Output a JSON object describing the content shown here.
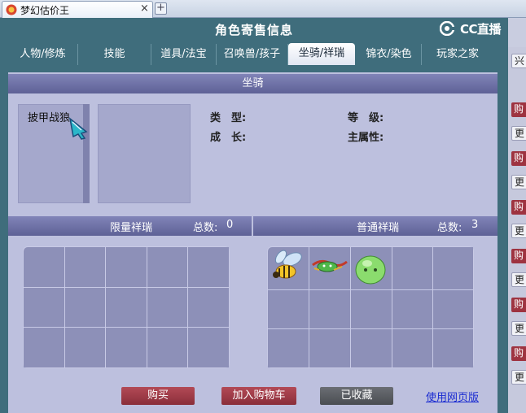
{
  "browser": {
    "tab_title": "梦幻估价王",
    "close_glyph": "×",
    "new_tab_glyph": "+"
  },
  "dialog": {
    "title": "角色寄售信息",
    "logo_text": "CC直播",
    "tabs": [
      {
        "label": "人物/修炼"
      },
      {
        "label": "技能"
      },
      {
        "label": "道具/法宝"
      },
      {
        "label": "召唤兽/孩子"
      },
      {
        "label": "坐骑/祥瑞",
        "active": true
      },
      {
        "label": "锦衣/染色"
      },
      {
        "label": "玩家之家"
      }
    ]
  },
  "mount": {
    "section_title": "坐骑",
    "name": "披甲战狼",
    "type_label": "类　型:",
    "level_label": "等　级:",
    "growth_label": "成　长:",
    "main_attr_label": "主属性:"
  },
  "limited": {
    "title": "限量祥瑞",
    "total_label": "总数:",
    "total": "0"
  },
  "normal": {
    "title": "普通祥瑞",
    "total_label": "总数:",
    "total": "3"
  },
  "actions": {
    "buy": "购买",
    "add_cart": "加入购物车",
    "favorited": "已收藏",
    "web_version": "使用网页版"
  },
  "side": {
    "top_label": "兴",
    "red_label": "购",
    "white_label": "更"
  },
  "colors": {
    "dialog_bg": "#3f6d7c",
    "header_bar": "#6c6fa5",
    "button_red": "#9e3a47",
    "link": "#1a2bd1"
  }
}
